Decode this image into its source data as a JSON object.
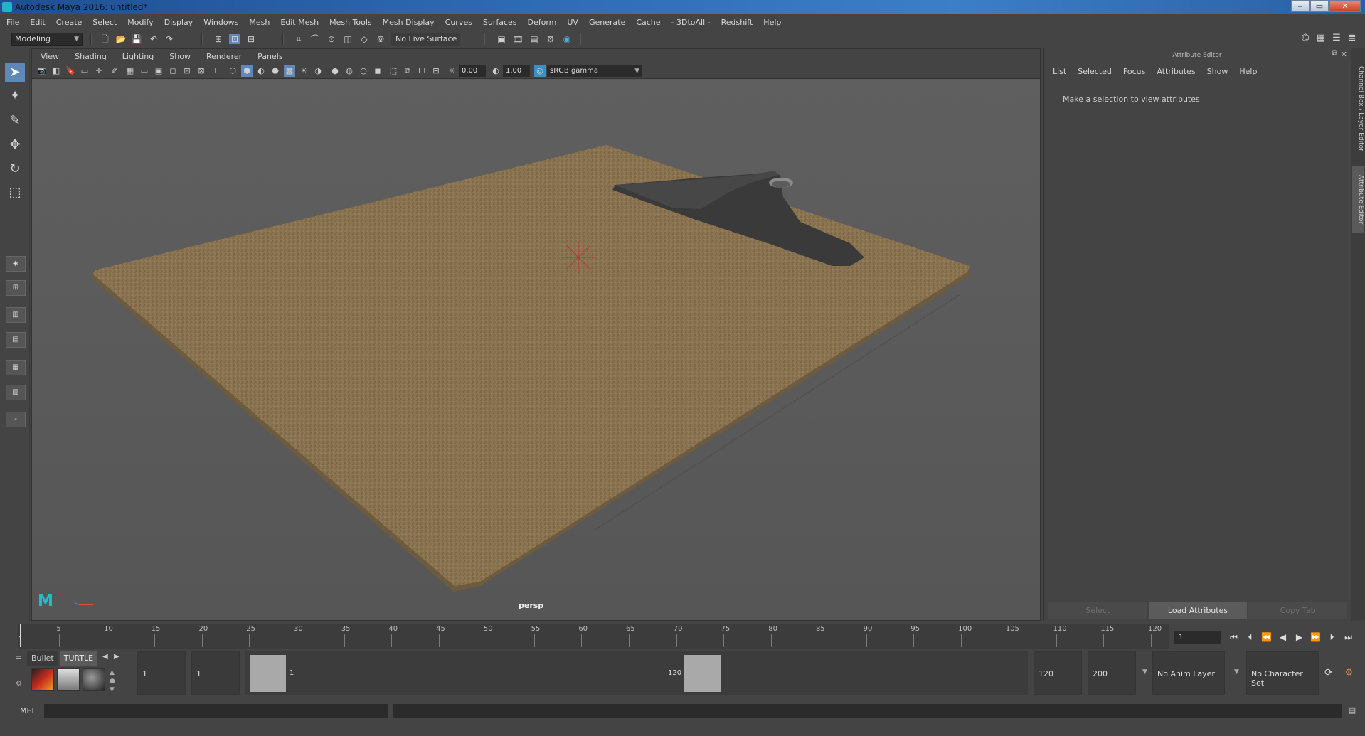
{
  "window": {
    "title": "Autodesk Maya 2016: untitled*",
    "controls": [
      "‒",
      "▭",
      "✕"
    ]
  },
  "menubar": [
    "File",
    "Edit",
    "Create",
    "Select",
    "Modify",
    "Display",
    "Windows",
    "Mesh",
    "Edit Mesh",
    "Mesh Tools",
    "Mesh Display",
    "Curves",
    "Surfaces",
    "Deform",
    "UV",
    "Generate",
    "Cache",
    "- 3DtoAll -",
    "Redshift",
    "Help"
  ],
  "statusline": {
    "mode": "Modeling",
    "live_surface": "No Live Surface"
  },
  "panel": {
    "menu": [
      "View",
      "Shading",
      "Lighting",
      "Show",
      "Renderer",
      "Panels"
    ],
    "exposure": "0.00",
    "gamma": "1.00",
    "colorspace": "sRGB gamma",
    "camera": "persp"
  },
  "attribute_editor": {
    "title": "Attribute Editor",
    "menu": [
      "List",
      "Selected",
      "Focus",
      "Attributes",
      "Show",
      "Help"
    ],
    "hint": "Make a selection to view attributes",
    "buttons": [
      "Select",
      "Load Attributes",
      "Copy Tab"
    ]
  },
  "side_tabs": [
    "Channel Box / Layer Editor",
    "Attribute Editor"
  ],
  "timeline": {
    "ticks": [
      "5",
      "10",
      "15",
      "20",
      "25",
      "30",
      "35",
      "40",
      "45",
      "50",
      "55",
      "60",
      "65",
      "70",
      "75",
      "80",
      "85",
      "90",
      "95",
      "100",
      "105",
      "110",
      "115",
      "120"
    ],
    "current_label": "1",
    "current_frame": "1"
  },
  "range": {
    "shelf_tabs": [
      "Bullet",
      "TURTLE"
    ],
    "start": "1",
    "playback_start": "1",
    "slider_start": "1",
    "slider_end": "120",
    "playback_end": "120",
    "end": "200",
    "anim_layer": "No Anim Layer",
    "character_set": "No Character Set"
  },
  "cmdline": {
    "label": "MEL"
  },
  "colors": {
    "viewport_bg": "#5c5c5c",
    "clipboard_board": "#8a7350",
    "clip_metal": "#3a3a3a",
    "active_tool": "#5d88b8"
  }
}
